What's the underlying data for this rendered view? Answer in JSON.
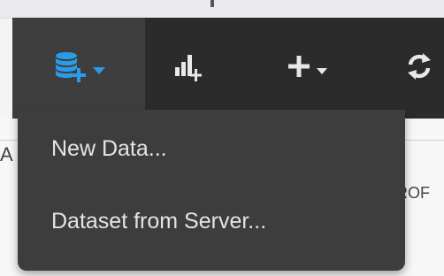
{
  "toolbar": {
    "buttons": [
      {
        "icon": "database-add-icon",
        "has_dropdown": true,
        "state": "active",
        "color": "#2b9be8"
      },
      {
        "icon": "chart-add-icon",
        "has_dropdown": false
      },
      {
        "icon": "plus-icon",
        "has_dropdown": true
      },
      {
        "icon": "refresh-icon",
        "has_dropdown": false
      }
    ]
  },
  "dropdown_menu": {
    "items": [
      {
        "label": "New Data..."
      },
      {
        "label": "Dataset from Server..."
      }
    ]
  },
  "background": {
    "left_text": "A",
    "right_text": "ROF"
  },
  "colors": {
    "toolbar_bg": "#2b2b2b",
    "menu_bg": "#3d3d3d",
    "accent_blue": "#2b9be8",
    "menu_text": "#e4e4e4"
  }
}
